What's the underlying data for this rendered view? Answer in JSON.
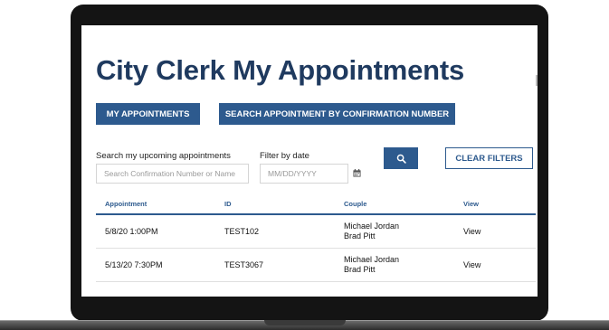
{
  "page": {
    "title": "City Clerk My Appointments"
  },
  "nav": {
    "my_appointments_label": "MY APPOINTMENTS",
    "search_by_confirmation_label": "SEARCH APPOINTMENT BY CONFIRMATION NUMBER"
  },
  "filters": {
    "search_label": "Search my upcoming appointments",
    "search_placeholder": "Search Confirmation Number or Name",
    "date_label": "Filter by date",
    "date_placeholder": "MM/DD/YYYY",
    "clear_label": "CLEAR FILTERS"
  },
  "table": {
    "headers": [
      "Appointment",
      "ID",
      "Couple",
      "View"
    ],
    "rows": [
      {
        "appointment": "5/8/20 1:00PM",
        "id": "TEST102",
        "couple": [
          "Michael Jordan",
          "Brad Pitt"
        ],
        "view": "View"
      },
      {
        "appointment": "5/13/20 7:30PM",
        "id": "TEST3067",
        "couple": [
          "Michael Jordan",
          "Brad Pitt"
        ],
        "view": "View"
      }
    ]
  },
  "icons": {
    "search_button": "search-icon",
    "date_picker": "calendar-icon"
  },
  "colors": {
    "primary": "#2d5a8e",
    "title": "#1f3a5f",
    "device_frame": "#141414"
  }
}
